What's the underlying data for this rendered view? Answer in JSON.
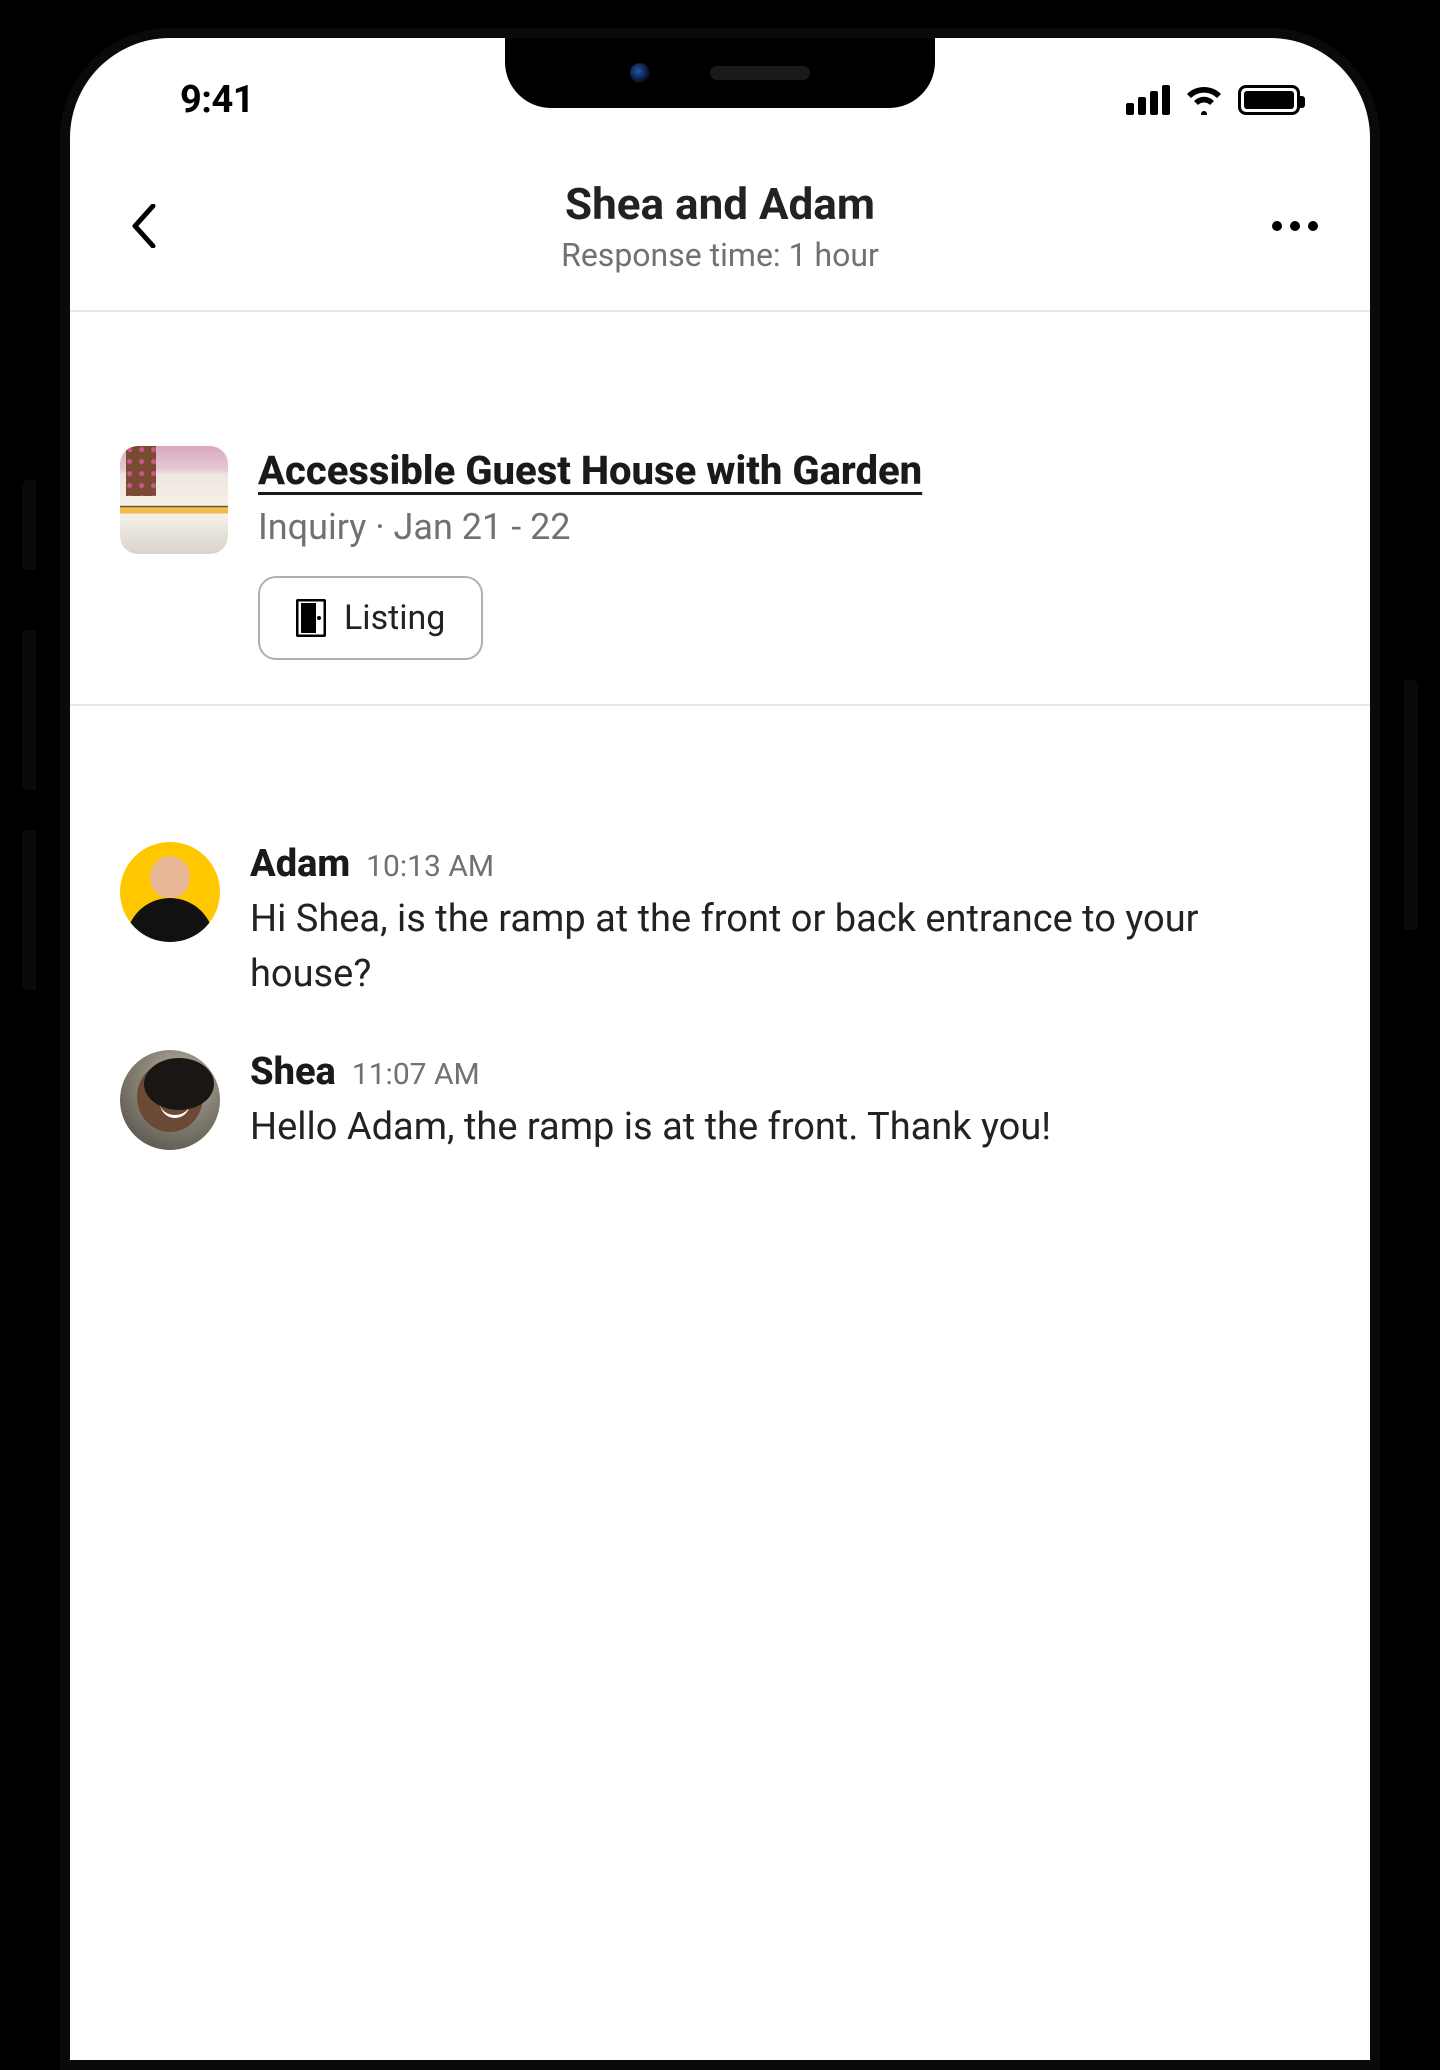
{
  "statusbar": {
    "time": "9:41"
  },
  "header": {
    "title": "Shea and Adam",
    "subtitle": "Response time: 1 hour"
  },
  "listing": {
    "title": "Accessible Guest House with Garden",
    "meta": "Inquiry · Jan 21 - 22",
    "button_label": "Listing"
  },
  "messages": [
    {
      "name": "Adam",
      "time": "10:13 AM",
      "text": "Hi Shea, is the ramp at the front or back entrance to your house?"
    },
    {
      "name": "Shea",
      "time": "11:07 AM",
      "text": "Hello Adam, the ramp is at the front. Thank you!"
    }
  ]
}
